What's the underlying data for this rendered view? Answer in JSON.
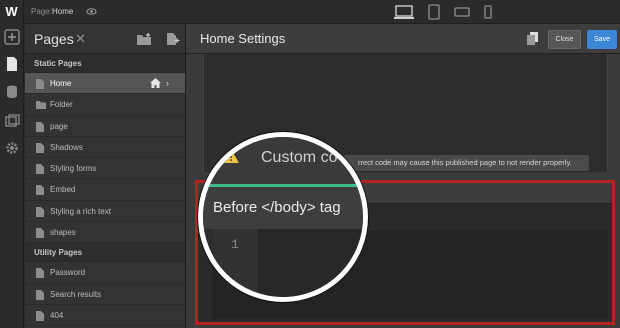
{
  "topbar": {
    "logo": "W",
    "page_label": "Page:",
    "page_name": "Home",
    "eye_icon": "eye-icon",
    "devices": [
      "desktop-icon",
      "tablet-icon",
      "mobile-landscape-icon",
      "mobile-portrait-icon"
    ]
  },
  "leftbar": {
    "icons": [
      "add-icon",
      "pages-icon",
      "cms-icon",
      "assets-icon",
      "settings-gear-icon"
    ]
  },
  "pages_panel": {
    "title": "Pages",
    "close_symbol": "✕",
    "static_section": "Static Pages",
    "static_pages": [
      {
        "label": "Home",
        "icon": "file-icon",
        "selected": true
      },
      {
        "label": "Folder",
        "icon": "folder-icon"
      },
      {
        "label": "page",
        "icon": "file-icon"
      },
      {
        "label": "Shadows",
        "icon": "file-icon"
      },
      {
        "label": "Styling forms",
        "icon": "file-icon"
      },
      {
        "label": "Embed",
        "icon": "file-icon"
      },
      {
        "label": "Styling a rich text",
        "icon": "file-icon"
      },
      {
        "label": "shapes",
        "icon": "file-icon"
      }
    ],
    "utility_section": "Utility Pages",
    "utility_pages": [
      {
        "label": "Password",
        "icon": "file-icon"
      },
      {
        "label": "Search results",
        "icon": "file-icon"
      },
      {
        "label": "404",
        "icon": "file-icon"
      }
    ]
  },
  "settings": {
    "title": "Home Settings",
    "close_label": "Close",
    "save_label": "Save",
    "warning_text": "rrect code may cause this published page to not render properly."
  },
  "zoom": {
    "warning_heading": "Custom co",
    "editor_label": "Before </body> tag",
    "line_number": "1"
  },
  "colors": {
    "highlight_border": "#b42222",
    "save_blue": "#3c87d6",
    "warning_yellow": "#e8c547"
  }
}
